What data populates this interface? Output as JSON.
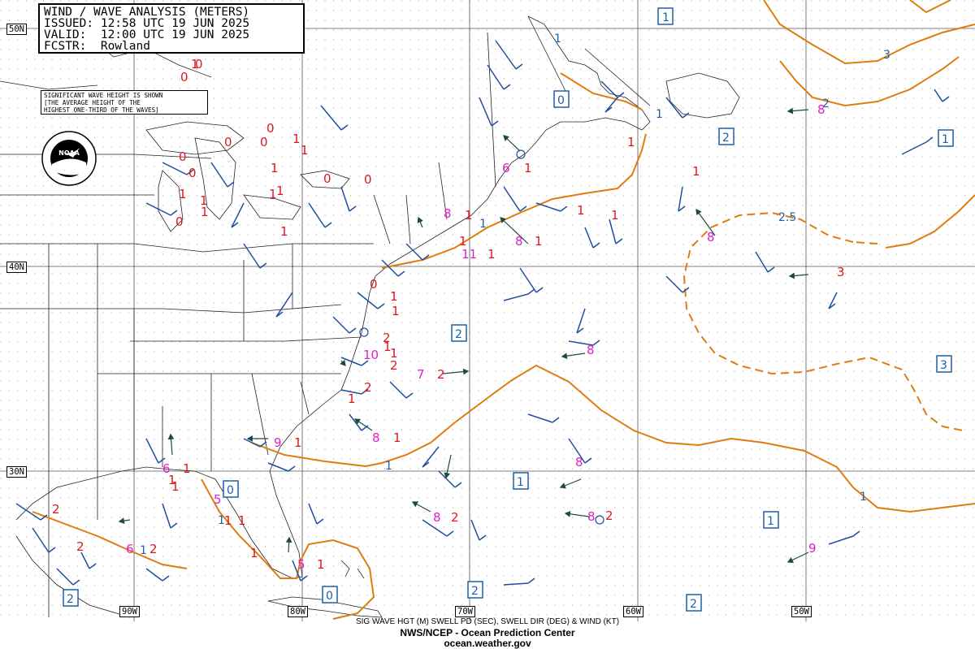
{
  "header": {
    "title": "WIND / WAVE ANALYSIS (METERS)",
    "issued": "ISSUED: 12:58 UTC 19 JUN 2025",
    "valid": "VALID:  12:00 UTC 19 JUN 2025",
    "forecaster": "FCSTR:  Rowland"
  },
  "note": {
    "line1": "SIGNIFICANT WAVE HEIGHT IS SHOWN",
    "line2": "[THE AVERAGE HEIGHT OF THE",
    "line3": "HIGHEST ONE-THIRD OF THE WAVES]"
  },
  "footer": {
    "line1": "SIG WAVE HGT (M) SWELL PD (SEC), SWELL DIR (DEG) & WIND (KT)",
    "line2": "NWS/NCEP - Ocean Prediction Center",
    "line3": "ocean.weather.gov"
  },
  "lat_labels": [
    "50N",
    "40N",
    "30N"
  ],
  "lon_labels": [
    "90W",
    "80W",
    "70W",
    "60W",
    "50W"
  ],
  "colors": {
    "contour": "#e07b10",
    "wind_barb": "#1f4e9e",
    "wave_height": "#e0161e",
    "swell_period": "#e020c8",
    "swell_arrow": "#1f4a3f",
    "contour_label": "#1f5fa8",
    "boxed_label": "#1f5fa8"
  },
  "contour_labels": [
    "3",
    "2.5",
    "2",
    "1",
    "1",
    "1",
    "1",
    "1",
    "1",
    "1"
  ],
  "boxed_labels": [
    "1",
    "0",
    "2",
    "1",
    "2",
    "3",
    "1",
    "1",
    "0",
    "0",
    "2",
    "2",
    "2"
  ],
  "wave_heights": [
    "0",
    "0",
    "0",
    "0",
    "0",
    "0",
    "0",
    "0",
    "0",
    "0",
    "0",
    "1",
    "1",
    "1",
    "1",
    "1",
    "1",
    "1",
    "1",
    "1",
    "1",
    "1",
    "1",
    "1",
    "1",
    "1",
    "1",
    "1",
    "1",
    "1",
    "1",
    "1",
    "1",
    "1",
    "1",
    "1",
    "1",
    "1",
    "1",
    "1",
    "1",
    "1",
    "1",
    "1",
    "2",
    "2",
    "2",
    "2",
    "2",
    "2",
    "2",
    "2",
    "2",
    "3"
  ],
  "swell_periods": [
    "6",
    "8",
    "8",
    "11",
    "10",
    "7",
    "8",
    "9",
    "6",
    "5",
    "8",
    "8",
    "8",
    "8",
    "9",
    "6",
    "5",
    "8",
    "8"
  ],
  "logo_text": "NOAA"
}
